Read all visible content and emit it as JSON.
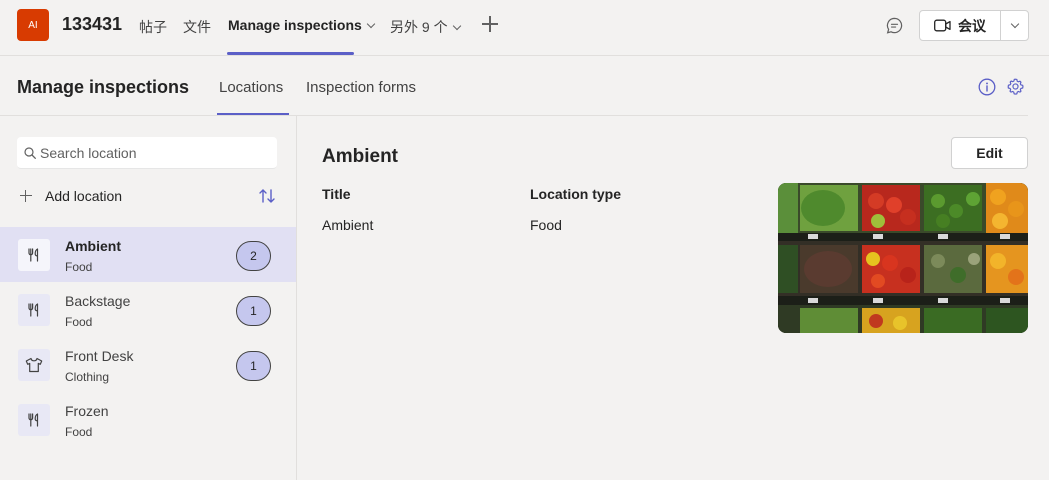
{
  "header": {
    "team_avatar": "AI",
    "team_name": "133431",
    "tabs": [
      {
        "label": "帖子"
      },
      {
        "label": "文件"
      },
      {
        "label": "Manage inspections"
      },
      {
        "label": "另外 9 个"
      }
    ],
    "meet_label": "会议"
  },
  "app": {
    "title": "Manage inspections",
    "tabs": [
      {
        "label": "Locations"
      },
      {
        "label": "Inspection forms"
      }
    ]
  },
  "sidebar": {
    "search_placeholder": "Search location",
    "add_label": "Add location",
    "locations": [
      {
        "name": "Ambient",
        "type": "Food",
        "count": "2",
        "icon": "fork-knife-icon"
      },
      {
        "name": "Backstage",
        "type": "Food",
        "count": "1",
        "icon": "fork-knife-icon"
      },
      {
        "name": "Front Desk",
        "type": "Clothing",
        "count": "1",
        "icon": "shirt-icon"
      },
      {
        "name": "Frozen",
        "type": "Food",
        "count": "",
        "icon": "fork-knife-icon"
      }
    ]
  },
  "detail": {
    "title": "Ambient",
    "edit_label": "Edit",
    "fields": [
      {
        "label": "Title",
        "value": "Ambient"
      },
      {
        "label": "Location type",
        "value": "Food"
      }
    ]
  },
  "colors": {
    "accent": "#5b5fc7",
    "selected_row": "#e1e0f3",
    "badge": "#c5c7ee",
    "team_avatar": "#d83b01"
  }
}
